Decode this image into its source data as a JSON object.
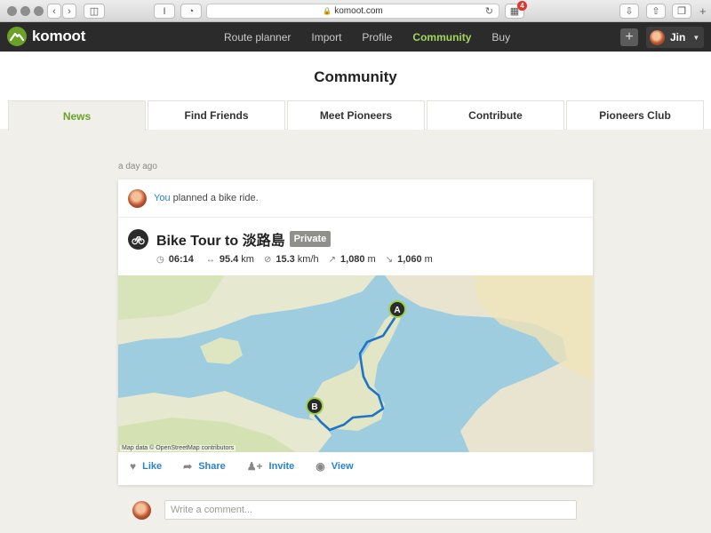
{
  "browser": {
    "url": "komoot.com",
    "extension_badge": "4",
    "tab_toolbar_label": "I"
  },
  "nav": {
    "logo": "komoot",
    "links": [
      "Route planner",
      "Import",
      "Profile",
      "Community",
      "Buy"
    ],
    "active_link": "Community",
    "plus_label": "+",
    "user_name": "Jin"
  },
  "page": {
    "title": "Community",
    "tabs": [
      "News",
      "Find Friends",
      "Meet Pioneers",
      "Contribute",
      "Pioneers Club"
    ],
    "active_tab": "News"
  },
  "feed": {
    "timestamp": "a day ago",
    "post": {
      "actor": "You",
      "activity_text": " planned a bike ride.",
      "tour_title": "Bike Tour to 淡路島",
      "visibility_badge": "Private",
      "stats": {
        "duration": "06:14",
        "distance_value": "95.4",
        "distance_unit": "km",
        "speed_value": "15.3",
        "speed_unit": "km/h",
        "uphill_value": "1,080",
        "uphill_unit": "m",
        "downhill_value": "1,060",
        "downhill_unit": "m"
      },
      "map": {
        "credit": "Map data © OpenStreetMap contributors",
        "start_marker": "A",
        "end_marker": "B",
        "route_color": "#1e74c6",
        "marker_color": "#2b2b2b",
        "marker_ring_color": "#9cd04a"
      },
      "actions": [
        "Like",
        "Share",
        "Invite",
        "View"
      ]
    },
    "comment_placeholder": "Write a comment..."
  },
  "colors": {
    "brand_green": "#6aa127",
    "nav_active": "#a3d55c",
    "link_blue": "#2a82c9"
  }
}
